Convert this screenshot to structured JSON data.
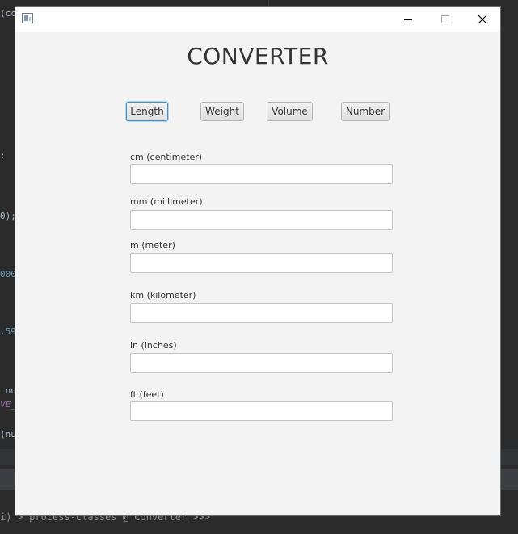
{
  "ide": {
    "code_lines": [
      "(cc",
      ":",
      "0);",
      "000",
      ".59",
      " nu",
      "VE_",
      "(nu"
    ],
    "status_text": "i) > process-classes @ Converter >>>"
  },
  "app": {
    "title": "CONVERTER",
    "window_controls": {
      "minimize_icon": "minimize-icon",
      "maximize_icon": "maximize-icon",
      "close_icon": "close-icon"
    },
    "tabs": [
      {
        "label": "Length",
        "active": true
      },
      {
        "label": "Weight",
        "active": false
      },
      {
        "label": "Volume",
        "active": false
      },
      {
        "label": "Number",
        "active": false
      }
    ],
    "fields": [
      {
        "label": "cm (centimeter)",
        "value": "",
        "placeholder": ""
      },
      {
        "label": "mm (millimeter)",
        "value": "",
        "placeholder": ""
      },
      {
        "label": "m (meter)",
        "value": "",
        "placeholder": ""
      },
      {
        "label": "km (kilometer)",
        "value": "",
        "placeholder": ""
      },
      {
        "label": "in (inches)",
        "value": "",
        "placeholder": ""
      },
      {
        "label": "ft (feet)",
        "value": "",
        "placeholder": ""
      }
    ]
  },
  "colors": {
    "window_bg": "#f3f3f3",
    "active_tab_border": "#3e98d6",
    "ide_bg": "#2b2b2b"
  }
}
